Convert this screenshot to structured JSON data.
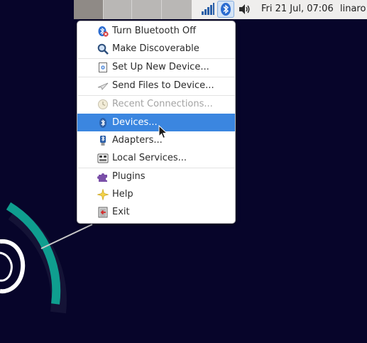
{
  "panel": {
    "clock": "Fri 21 Jul, 07:06",
    "user": "linaro",
    "tray_icons": [
      "network-signal-icon",
      "bluetooth-icon",
      "volume-icon"
    ]
  },
  "menu": {
    "items": [
      {
        "label": "Turn Bluetooth Off",
        "icon": "bluetooth-off-icon",
        "enabled": true,
        "selected": false
      },
      {
        "label": "Make Discoverable",
        "icon": "magnifier-icon",
        "enabled": true,
        "selected": false
      },
      {
        "label": "Set Up New Device...",
        "icon": "new-device-icon",
        "enabled": true,
        "selected": false
      },
      {
        "label": "Send Files to Device...",
        "icon": "send-file-icon",
        "enabled": true,
        "selected": false
      },
      {
        "label": "Recent Connections...",
        "icon": "recent-clock-icon",
        "enabled": false,
        "selected": false
      },
      {
        "label": "Devices...",
        "icon": "bluetooth-devices-icon",
        "enabled": true,
        "selected": true
      },
      {
        "label": "Adapters...",
        "icon": "adapter-icon",
        "enabled": true,
        "selected": false
      },
      {
        "label": "Local Services...",
        "icon": "local-services-icon",
        "enabled": true,
        "selected": false
      },
      {
        "label": "Plugins",
        "icon": "puzzle-piece-icon",
        "enabled": true,
        "selected": false
      },
      {
        "label": "Help",
        "icon": "help-star-icon",
        "enabled": true,
        "selected": false
      },
      {
        "label": "Exit",
        "icon": "exit-door-icon",
        "enabled": true,
        "selected": false
      }
    ]
  },
  "colors": {
    "desktop": "#07052a",
    "selection": "#3b86e0",
    "teal_accent": "#0f9e8f",
    "panel": "#efeeed"
  }
}
